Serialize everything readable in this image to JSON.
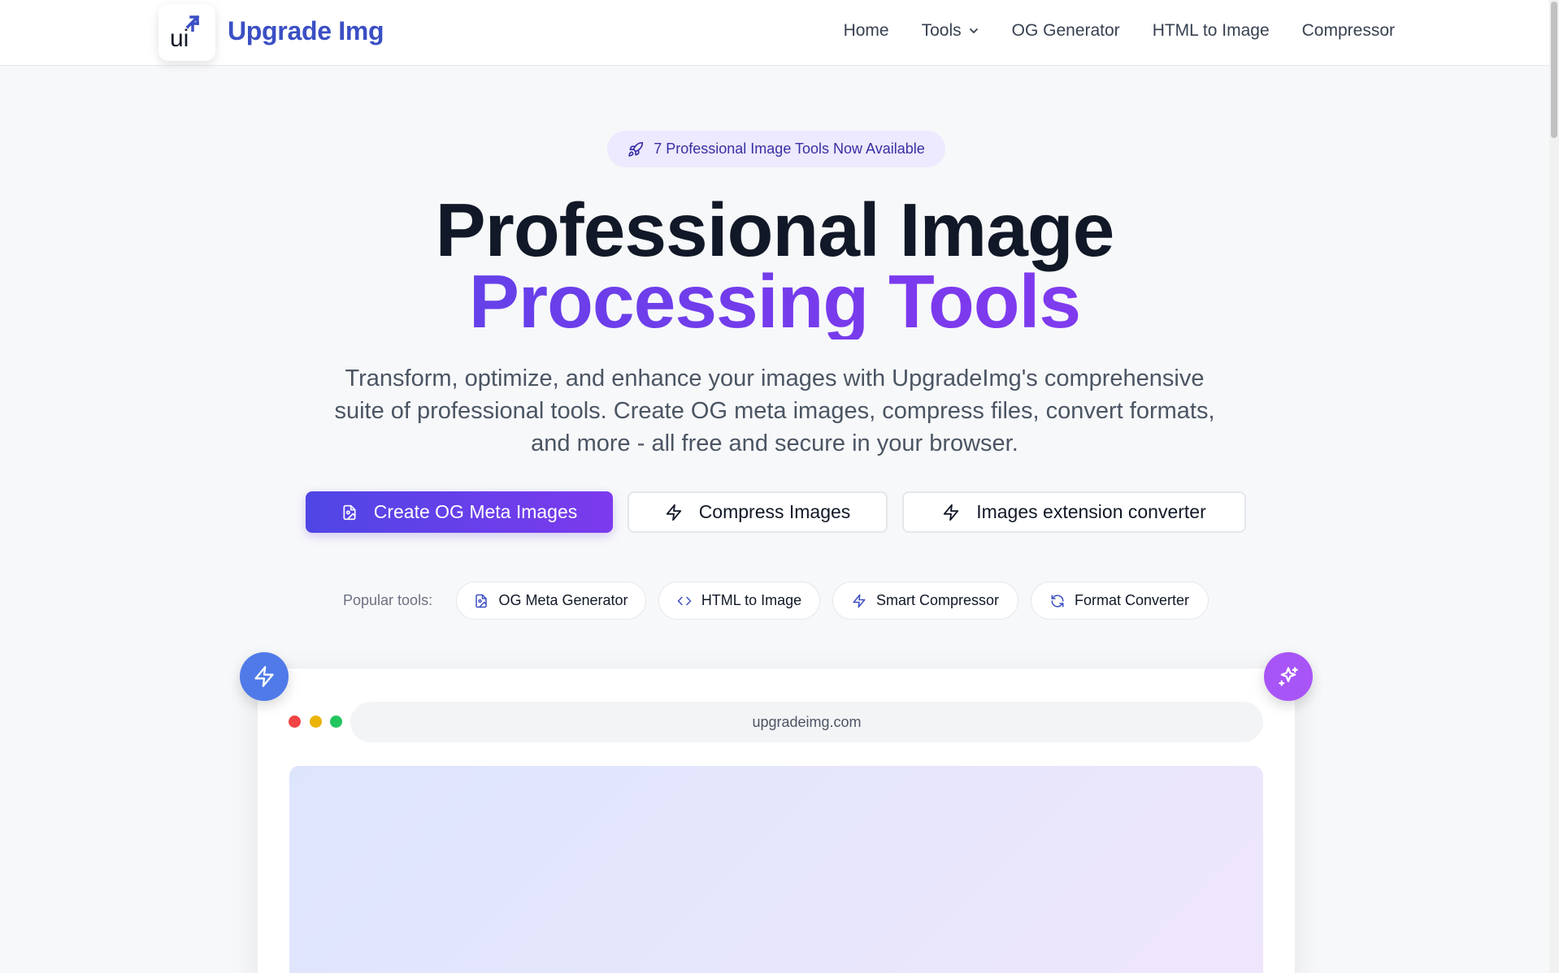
{
  "header": {
    "logo_text": "ui",
    "brand": "Upgrade Img",
    "nav": [
      {
        "label": "Home"
      },
      {
        "label": "Tools",
        "icon": "chevron-down-icon"
      },
      {
        "label": "OG Generator"
      },
      {
        "label": "HTML to Image"
      },
      {
        "label": "Compressor"
      }
    ]
  },
  "hero": {
    "badge": "7 Professional Image Tools Now Available",
    "badge_icon": "rocket-icon",
    "title_line1": "Professional Image",
    "title_line2": "Processing Tools",
    "description": "Transform, optimize, and enhance your images with UpgradeImg's comprehensive suite of professional tools. Create OG meta images, compress files, convert formats, and more - all free and secure in your browser.",
    "buttons": [
      {
        "label": "Create OG Meta Images",
        "icon": "image-file-icon"
      },
      {
        "label": "Compress Images",
        "icon": "zap-icon"
      },
      {
        "label": "Images extension converter",
        "icon": "zap-icon"
      }
    ]
  },
  "popular": {
    "label": "Popular tools:",
    "chips": [
      {
        "label": "OG Meta Generator",
        "icon": "image-file-icon"
      },
      {
        "label": "HTML to Image",
        "icon": "code-icon"
      },
      {
        "label": "Smart Compressor",
        "icon": "zap-icon"
      },
      {
        "label": "Format Converter",
        "icon": "refresh-icon"
      }
    ]
  },
  "preview": {
    "url": "upgradeimg.com"
  },
  "colors": {
    "brand": "#3b4fc4",
    "accent_start": "#4f46e5",
    "accent_end": "#7c3aed",
    "float_left": "#4f7ae8",
    "float_right": "#a855f7"
  }
}
